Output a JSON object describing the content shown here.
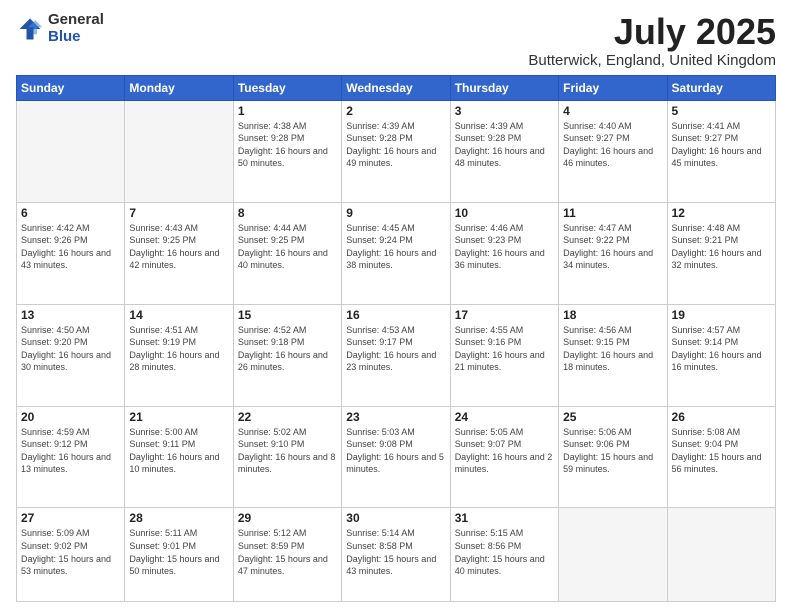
{
  "logo": {
    "general": "General",
    "blue": "Blue"
  },
  "header": {
    "title": "July 2025",
    "subtitle": "Butterwick, England, United Kingdom"
  },
  "weekdays": [
    "Sunday",
    "Monday",
    "Tuesday",
    "Wednesday",
    "Thursday",
    "Friday",
    "Saturday"
  ],
  "weeks": [
    [
      {
        "day": "",
        "empty": true
      },
      {
        "day": "",
        "empty": true
      },
      {
        "day": "1",
        "sunrise": "4:38 AM",
        "sunset": "9:28 PM",
        "daylight": "16 hours and 50 minutes."
      },
      {
        "day": "2",
        "sunrise": "4:39 AM",
        "sunset": "9:28 PM",
        "daylight": "16 hours and 49 minutes."
      },
      {
        "day": "3",
        "sunrise": "4:39 AM",
        "sunset": "9:28 PM",
        "daylight": "16 hours and 48 minutes."
      },
      {
        "day": "4",
        "sunrise": "4:40 AM",
        "sunset": "9:27 PM",
        "daylight": "16 hours and 46 minutes."
      },
      {
        "day": "5",
        "sunrise": "4:41 AM",
        "sunset": "9:27 PM",
        "daylight": "16 hours and 45 minutes."
      }
    ],
    [
      {
        "day": "6",
        "sunrise": "4:42 AM",
        "sunset": "9:26 PM",
        "daylight": "16 hours and 43 minutes."
      },
      {
        "day": "7",
        "sunrise": "4:43 AM",
        "sunset": "9:25 PM",
        "daylight": "16 hours and 42 minutes."
      },
      {
        "day": "8",
        "sunrise": "4:44 AM",
        "sunset": "9:25 PM",
        "daylight": "16 hours and 40 minutes."
      },
      {
        "day": "9",
        "sunrise": "4:45 AM",
        "sunset": "9:24 PM",
        "daylight": "16 hours and 38 minutes."
      },
      {
        "day": "10",
        "sunrise": "4:46 AM",
        "sunset": "9:23 PM",
        "daylight": "16 hours and 36 minutes."
      },
      {
        "day": "11",
        "sunrise": "4:47 AM",
        "sunset": "9:22 PM",
        "daylight": "16 hours and 34 minutes."
      },
      {
        "day": "12",
        "sunrise": "4:48 AM",
        "sunset": "9:21 PM",
        "daylight": "16 hours and 32 minutes."
      }
    ],
    [
      {
        "day": "13",
        "sunrise": "4:50 AM",
        "sunset": "9:20 PM",
        "daylight": "16 hours and 30 minutes."
      },
      {
        "day": "14",
        "sunrise": "4:51 AM",
        "sunset": "9:19 PM",
        "daylight": "16 hours and 28 minutes."
      },
      {
        "day": "15",
        "sunrise": "4:52 AM",
        "sunset": "9:18 PM",
        "daylight": "16 hours and 26 minutes."
      },
      {
        "day": "16",
        "sunrise": "4:53 AM",
        "sunset": "9:17 PM",
        "daylight": "16 hours and 23 minutes."
      },
      {
        "day": "17",
        "sunrise": "4:55 AM",
        "sunset": "9:16 PM",
        "daylight": "16 hours and 21 minutes."
      },
      {
        "day": "18",
        "sunrise": "4:56 AM",
        "sunset": "9:15 PM",
        "daylight": "16 hours and 18 minutes."
      },
      {
        "day": "19",
        "sunrise": "4:57 AM",
        "sunset": "9:14 PM",
        "daylight": "16 hours and 16 minutes."
      }
    ],
    [
      {
        "day": "20",
        "sunrise": "4:59 AM",
        "sunset": "9:12 PM",
        "daylight": "16 hours and 13 minutes."
      },
      {
        "day": "21",
        "sunrise": "5:00 AM",
        "sunset": "9:11 PM",
        "daylight": "16 hours and 10 minutes."
      },
      {
        "day": "22",
        "sunrise": "5:02 AM",
        "sunset": "9:10 PM",
        "daylight": "16 hours and 8 minutes."
      },
      {
        "day": "23",
        "sunrise": "5:03 AM",
        "sunset": "9:08 PM",
        "daylight": "16 hours and 5 minutes."
      },
      {
        "day": "24",
        "sunrise": "5:05 AM",
        "sunset": "9:07 PM",
        "daylight": "16 hours and 2 minutes."
      },
      {
        "day": "25",
        "sunrise": "5:06 AM",
        "sunset": "9:06 PM",
        "daylight": "15 hours and 59 minutes."
      },
      {
        "day": "26",
        "sunrise": "5:08 AM",
        "sunset": "9:04 PM",
        "daylight": "15 hours and 56 minutes."
      }
    ],
    [
      {
        "day": "27",
        "sunrise": "5:09 AM",
        "sunset": "9:02 PM",
        "daylight": "15 hours and 53 minutes."
      },
      {
        "day": "28",
        "sunrise": "5:11 AM",
        "sunset": "9:01 PM",
        "daylight": "15 hours and 50 minutes."
      },
      {
        "day": "29",
        "sunrise": "5:12 AM",
        "sunset": "8:59 PM",
        "daylight": "15 hours and 47 minutes."
      },
      {
        "day": "30",
        "sunrise": "5:14 AM",
        "sunset": "8:58 PM",
        "daylight": "15 hours and 43 minutes."
      },
      {
        "day": "31",
        "sunrise": "5:15 AM",
        "sunset": "8:56 PM",
        "daylight": "15 hours and 40 minutes."
      },
      {
        "day": "",
        "empty": true
      },
      {
        "day": "",
        "empty": true
      }
    ]
  ]
}
